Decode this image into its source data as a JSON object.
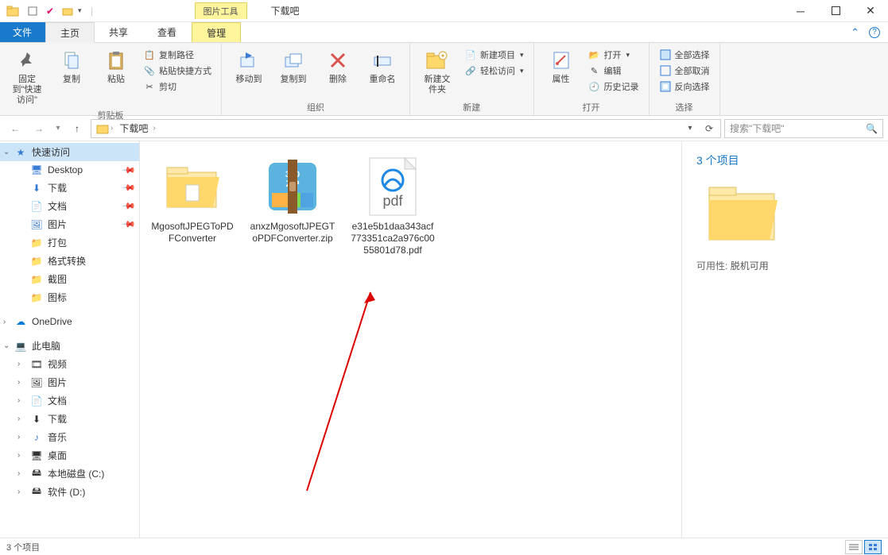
{
  "window": {
    "title": "下载吧",
    "contextual_tab_group": "图片工具"
  },
  "tabs": {
    "file": "文件",
    "home": "主页",
    "share": "共享",
    "view": "查看",
    "manage": "管理"
  },
  "ribbon": {
    "clipboard": {
      "label": "剪贴板",
      "pin": "固定到\"快速访问\"",
      "copy": "复制",
      "paste": "粘贴",
      "copy_path": "复制路径",
      "paste_shortcut": "粘贴快捷方式",
      "cut": "剪切"
    },
    "organize": {
      "label": "组织",
      "move_to": "移动到",
      "copy_to": "复制到",
      "delete": "删除",
      "rename": "重命名"
    },
    "new": {
      "label": "新建",
      "new_folder": "新建文件夹",
      "new_item": "新建项目",
      "easy_access": "轻松访问"
    },
    "open": {
      "label": "打开",
      "properties": "属性",
      "open": "打开",
      "edit": "编辑",
      "history": "历史记录"
    },
    "select": {
      "label": "选择",
      "select_all": "全部选择",
      "select_none": "全部取消",
      "invert": "反向选择"
    }
  },
  "address": {
    "segments": [
      "下载吧"
    ],
    "search_placeholder": "搜索\"下载吧\""
  },
  "sidebar": {
    "quick_access": "快速访问",
    "items_qa": [
      {
        "label": "Desktop",
        "pinned": true
      },
      {
        "label": "下载",
        "pinned": true
      },
      {
        "label": "文档",
        "pinned": true
      },
      {
        "label": "图片",
        "pinned": true
      },
      {
        "label": "打包"
      },
      {
        "label": "格式转换"
      },
      {
        "label": "截图"
      },
      {
        "label": "图标"
      }
    ],
    "onedrive": "OneDrive",
    "this_pc": "此电脑",
    "items_pc": [
      {
        "label": "视频"
      },
      {
        "label": "图片"
      },
      {
        "label": "文档"
      },
      {
        "label": "下载"
      },
      {
        "label": "音乐"
      },
      {
        "label": "桌面"
      },
      {
        "label": "本地磁盘 (C:)"
      },
      {
        "label": "软件 (D:)"
      }
    ]
  },
  "files": [
    {
      "name": "MgosoftJPEGToPDFConverter",
      "type": "folder"
    },
    {
      "name": "anxzMgosoftJPEGToPDFConverter.zip",
      "type": "zip"
    },
    {
      "name": "e31e5b1daa343acf773351ca2a976c0055801d78.pdf",
      "type": "pdf"
    }
  ],
  "details": {
    "title": "3 个项目",
    "availability_key": "可用性:",
    "availability_val": "脱机可用"
  },
  "statusbar": {
    "count": "3 个项目"
  }
}
